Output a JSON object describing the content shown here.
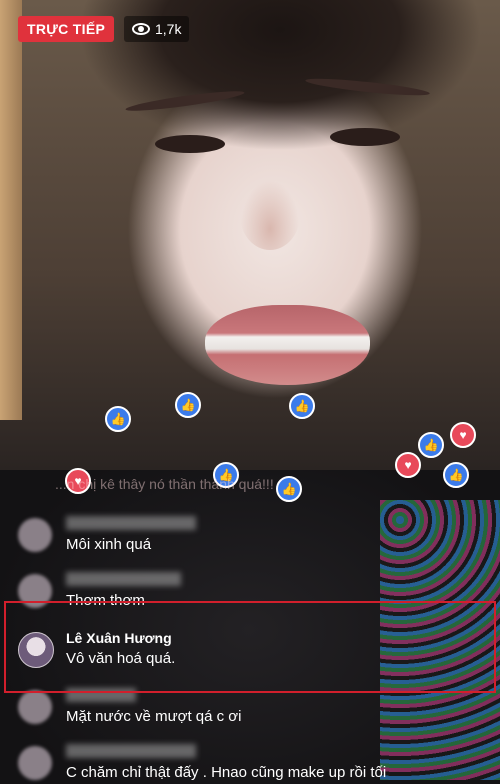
{
  "live": {
    "badge": "TRỰC TIẾP",
    "viewers": "1,7k"
  },
  "faded_comment": "...n chị kê thây nó thần thánh quá!!!",
  "comments": [
    {
      "name": "",
      "text": "Môi xinh quá"
    },
    {
      "name": "",
      "text": "Thơm thơm"
    },
    {
      "name": "Lê Xuân Hương",
      "text": "Vô văn hoá quá."
    },
    {
      "name": "",
      "text": "Mặt nước về mượt qá c ơi"
    },
    {
      "name": "",
      "text": "C chăm chỉ thật đấy . Hnao cũng make up rồi tối"
    }
  ],
  "colors": {
    "live_badge": "#e0323c",
    "like": "#3b7bea",
    "love": "#e8495a",
    "highlight": "#d21f2c"
  },
  "icons": {
    "viewers": "eye-icon",
    "like": "thumbs-up-icon",
    "love": "heart-icon"
  }
}
